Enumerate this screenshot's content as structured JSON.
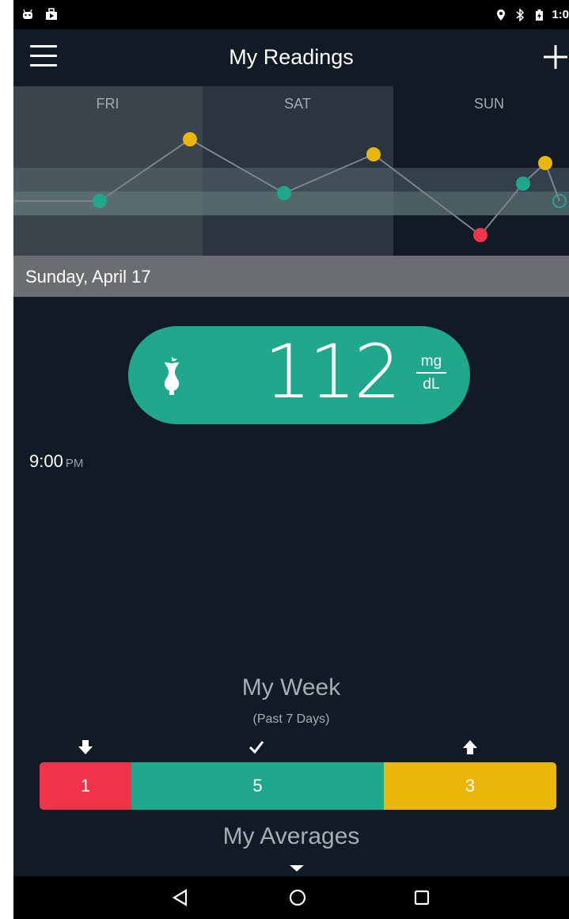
{
  "status_bar": {
    "time": "1:0"
  },
  "header": {
    "title": "My Readings"
  },
  "chart_data": {
    "type": "line",
    "categories": [
      "FRI",
      "SAT",
      "SUN"
    ]
  },
  "date_bar": {
    "date": "Sunday, April 17"
  },
  "reading": {
    "value": "112",
    "unit_numerator": "mg",
    "unit_denominator": "dL",
    "time": "9:00",
    "ampm": "PM",
    "icon": "apple-core-icon"
  },
  "week": {
    "title": "My Week",
    "subtitle": "(Past 7 Days)",
    "low_count": "1",
    "in_range_count": "5",
    "high_count": "3"
  },
  "averages": {
    "title": "My Averages"
  },
  "colors": {
    "background": "#111b26",
    "in_range": "#1fa88b",
    "low": "#f0344a",
    "high": "#eab60c"
  }
}
